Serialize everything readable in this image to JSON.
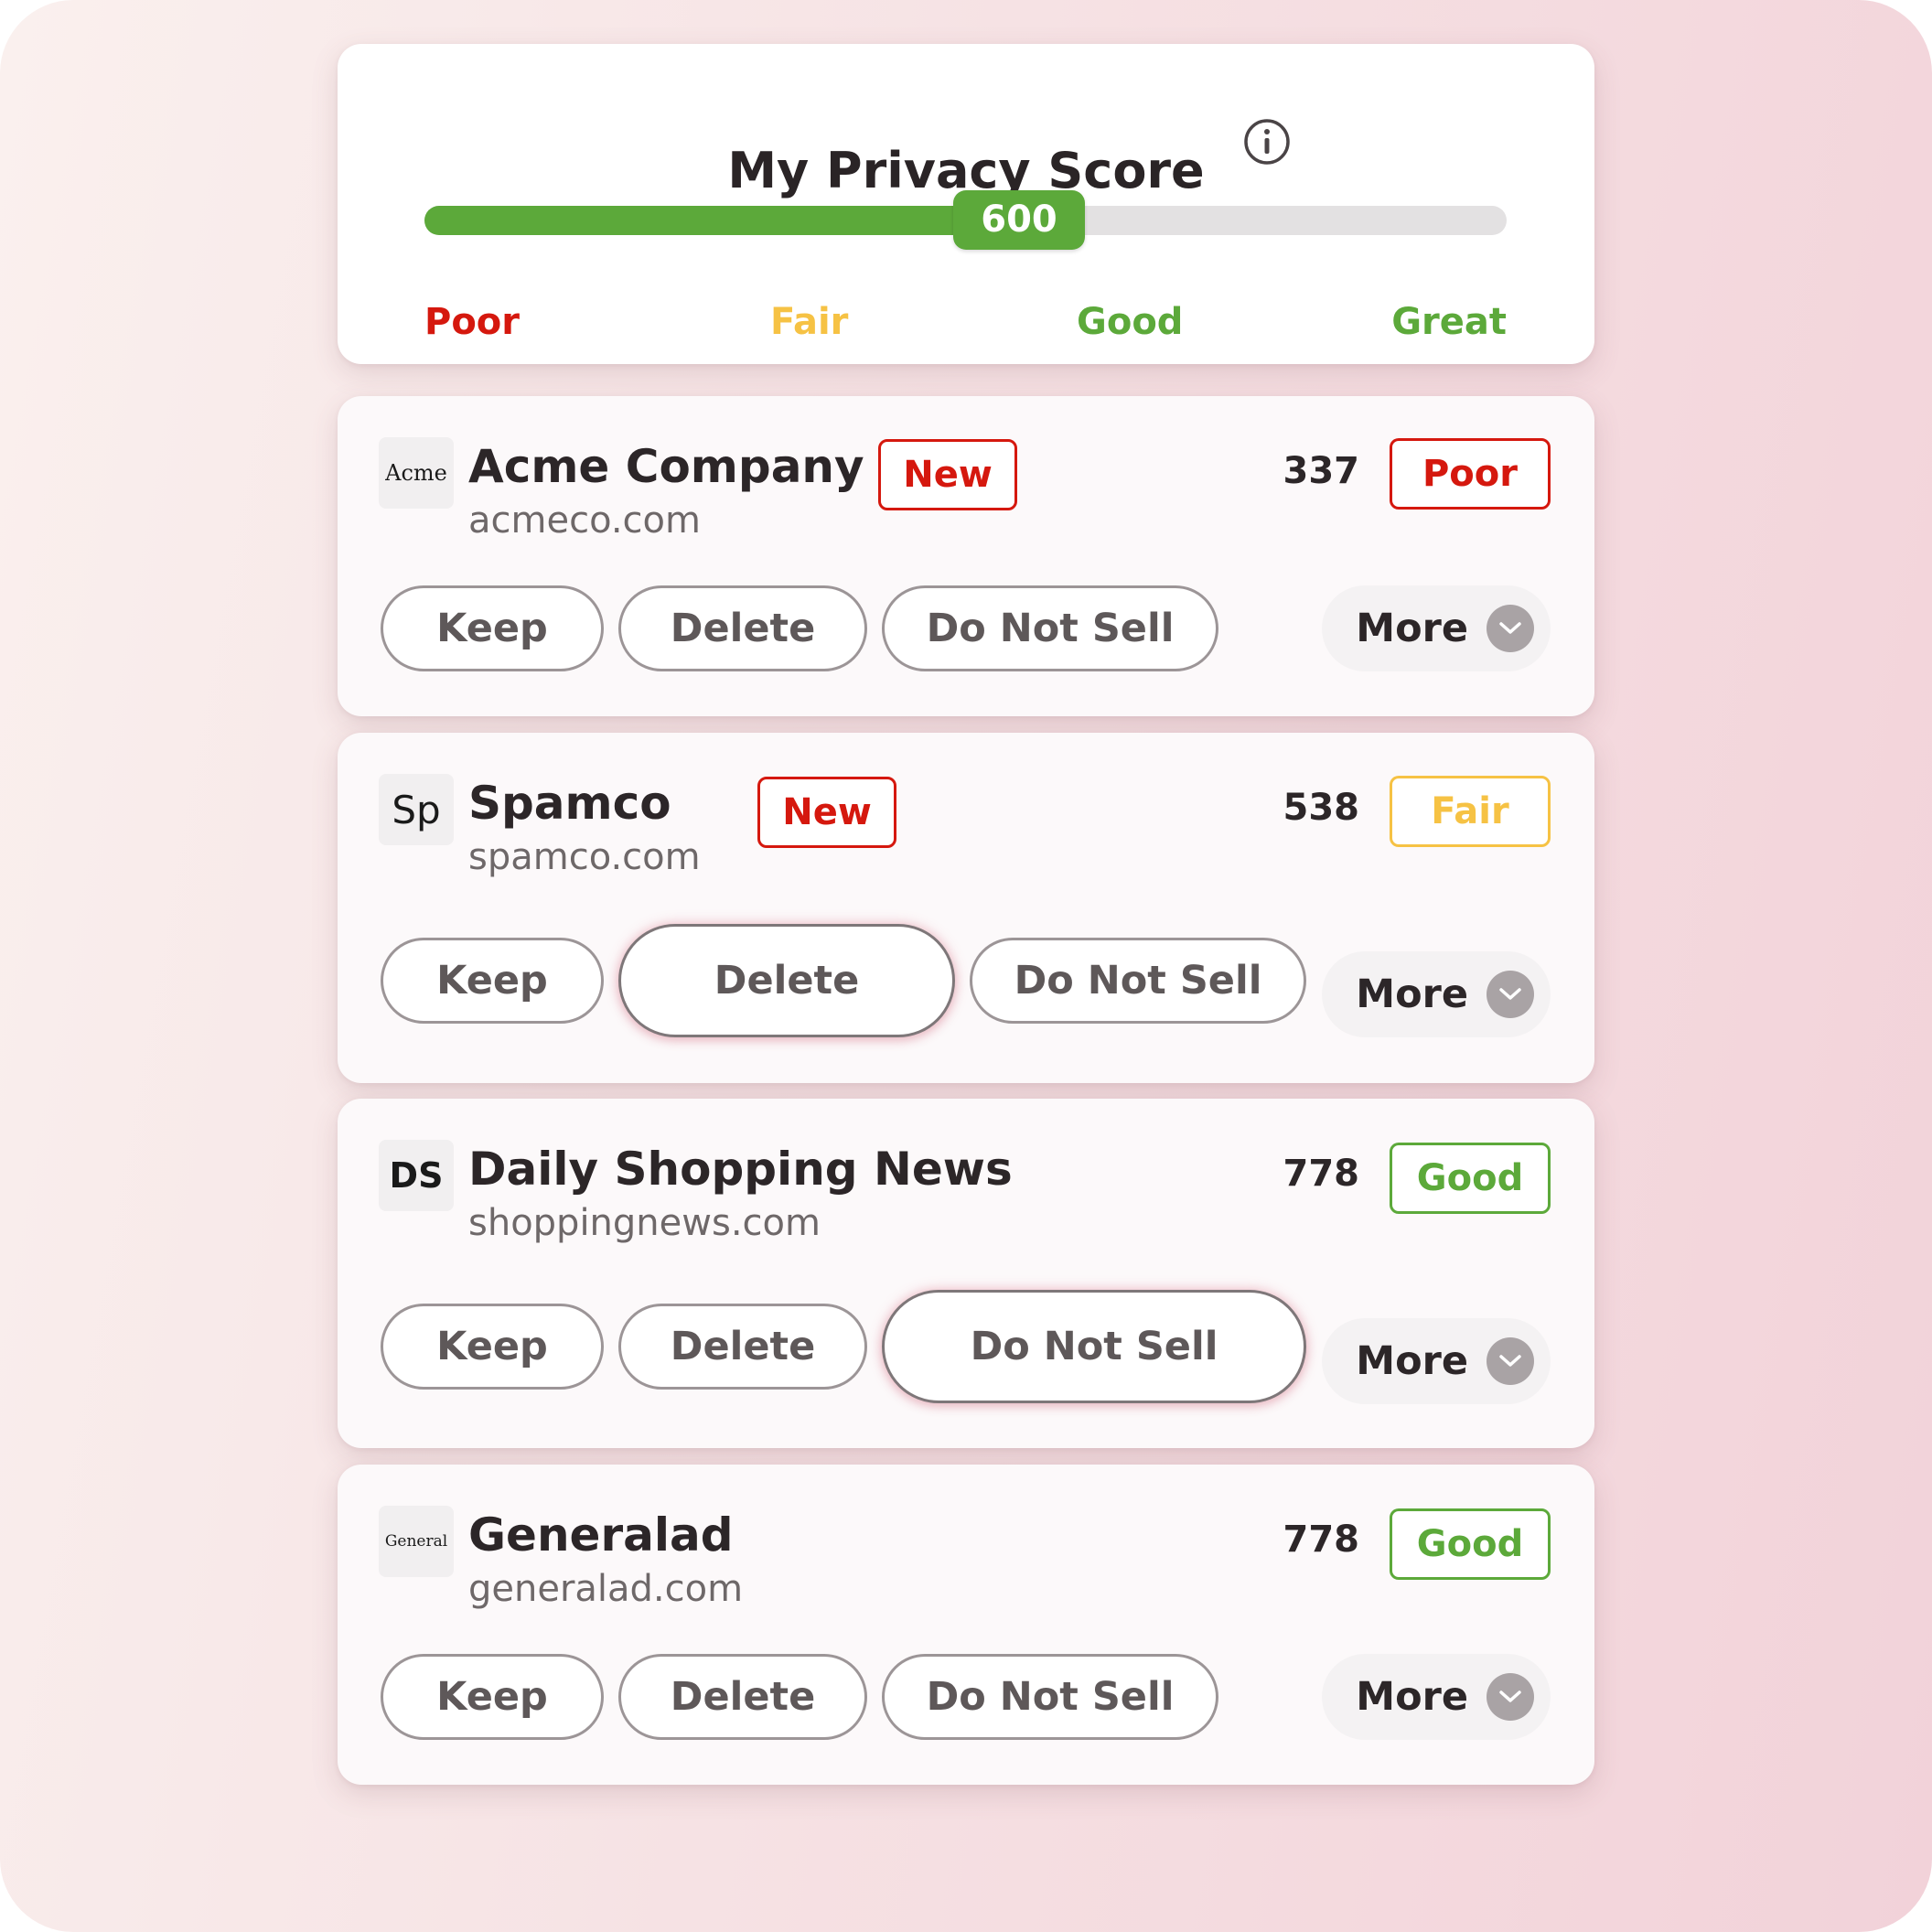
{
  "header": {
    "title": "My Privacy Score",
    "score": "600",
    "score_fraction": 0.607,
    "scale": [
      "Poor",
      "Fair",
      "Good",
      "Great"
    ]
  },
  "actions": {
    "keep": "Keep",
    "delete": "Delete",
    "do_not_sell": "Do Not Sell",
    "more": "More"
  },
  "companies": [
    {
      "logo": "Acme",
      "name": "Acme Company",
      "domain": "acmeco.com",
      "badge": "New",
      "score": "337",
      "rating": "Poor",
      "selected_action": "none"
    },
    {
      "logo": "Sp",
      "name": "Spamco",
      "domain": "spamco.com",
      "badge": "New",
      "score": "538",
      "rating": "Fair",
      "selected_action": "delete"
    },
    {
      "logo": "DS",
      "name": "Daily Shopping News",
      "domain": "shoppingnews.com",
      "badge": "",
      "score": "778",
      "rating": "Good",
      "selected_action": "do_not_sell"
    },
    {
      "logo": "General",
      "name": "Generalad",
      "domain": "generalad.com",
      "badge": "",
      "score": "778",
      "rating": "Good",
      "selected_action": "none"
    }
  ],
  "colors": {
    "poor": "#d5180e",
    "fair": "#f6c244",
    "good": "#5ca93a",
    "track": "#e3e1e2"
  },
  "icons": {
    "info": "info-icon",
    "more": "chevron-down-icon"
  }
}
